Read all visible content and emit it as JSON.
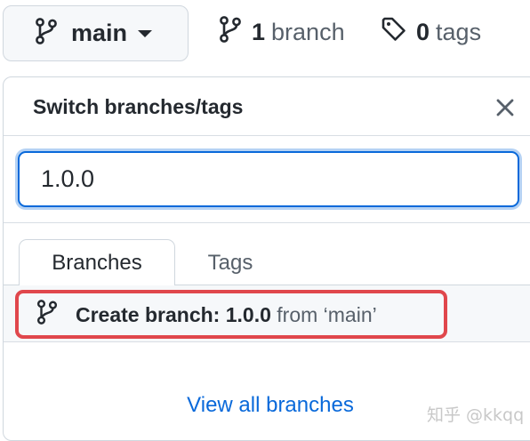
{
  "topbar": {
    "current_branch": "main",
    "branch_count": "1",
    "branch_word": "branch",
    "tag_count": "0",
    "tag_word": "tags"
  },
  "panel": {
    "title": "Switch branches/tags",
    "filter": {
      "value": "1.0.0"
    },
    "tabs": [
      {
        "label": "Branches",
        "selected": true
      },
      {
        "label": "Tags",
        "selected": false
      }
    ],
    "create_row": {
      "prefix": "Create branch: ",
      "branch_name": "1.0.0",
      "suffix": " from ‘main’"
    },
    "view_all": "View all branches"
  },
  "watermark": "知乎 @kkqq",
  "colors": {
    "accent": "#0969da",
    "highlight": "#e0474c",
    "border": "#d0d7de",
    "muted_text": "#57606a"
  },
  "icons": [
    "git-branch-icon",
    "chevron-down-icon",
    "tag-icon",
    "close-icon"
  ]
}
